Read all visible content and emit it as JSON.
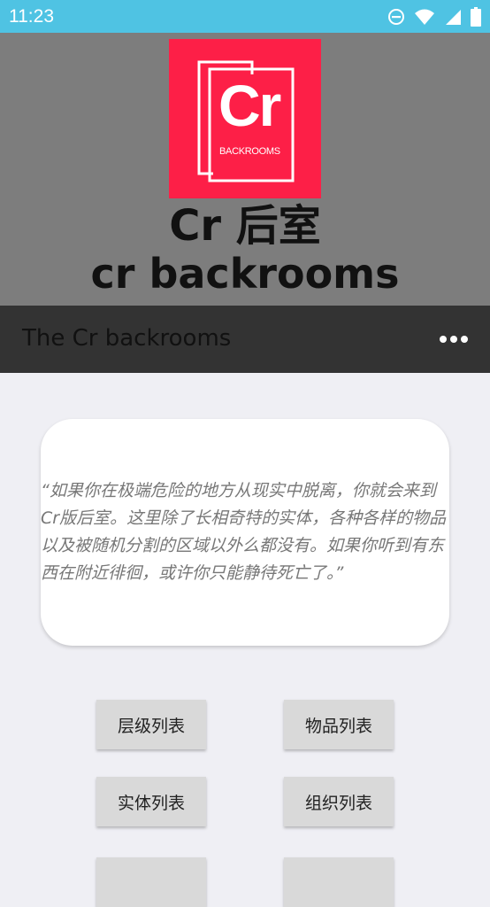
{
  "status_bar": {
    "time": "11:23",
    "icons": [
      "do-not-disturb-icon",
      "wifi-icon",
      "signal-icon",
      "battery-icon"
    ],
    "background": "#4fc3e3"
  },
  "banner": {
    "logo_text": "Cr",
    "logo_subtext": "BACKROOMS",
    "title_line1": "Cr 后室",
    "title_line2": "cr backrooms",
    "logo_color": "#fd1f47"
  },
  "app_bar": {
    "title": "The Cr backrooms",
    "menu_icon": "more-horizontal-icon"
  },
  "quote": {
    "text": "“如果你在极端危险的地方从现实中脱离，你就会来到Cr版后室。这里除了长相奇特的实体，各种各样的物品以及被随机分割的区域以外么都没有。如果你听到有东西在附近徘徊，或许你只能静待死亡了。”"
  },
  "buttons": {
    "levels": "层级列表",
    "items": "物品列表",
    "entities": "实体列表",
    "organizations": "组织列表",
    "more_left": "",
    "more_right": ""
  }
}
